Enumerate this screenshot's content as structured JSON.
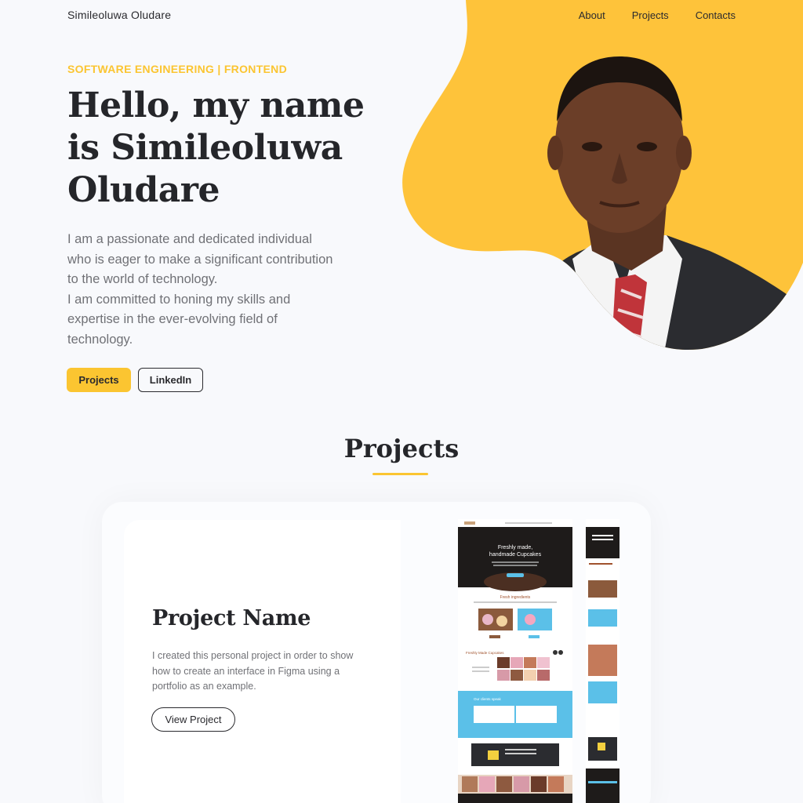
{
  "nav": {
    "brand": "Simileoluwa Oludare",
    "links": [
      "About",
      "Projects",
      "Contacts"
    ]
  },
  "hero": {
    "eyebrow": "SOFTWARE ENGINEERING | FRONTEND",
    "title": "Hello,  my name is Simileoluwa Oludare",
    "description": [
      "I am a passionate and dedicated individual who is eager to make a significant contribution to the world of technology.",
      "I am committed to honing my skills and expertise in the ever-evolving field of technology."
    ],
    "primary_button": "Projects",
    "secondary_button": "LinkedIn"
  },
  "projects_section": {
    "title": "Projects"
  },
  "project": {
    "name": "Project Name",
    "description": "I created this personal project in order to show how to create an interface in Figma using a portfolio as an example.",
    "button": "View Project"
  },
  "mockup": {
    "hero_heading": "Freshly made, handmade Cupcakes",
    "section1": "Fresh ingredients",
    "section2": "Freshly Made Cupcakes",
    "section3": "Our clients speak"
  },
  "colors": {
    "accent": "#fbc531",
    "text": "#25262a",
    "muted": "#707176",
    "background": "#f8f9fc",
    "mock_blue": "#5bc0e8"
  },
  "icons": {
    "portrait": "person-photo"
  }
}
